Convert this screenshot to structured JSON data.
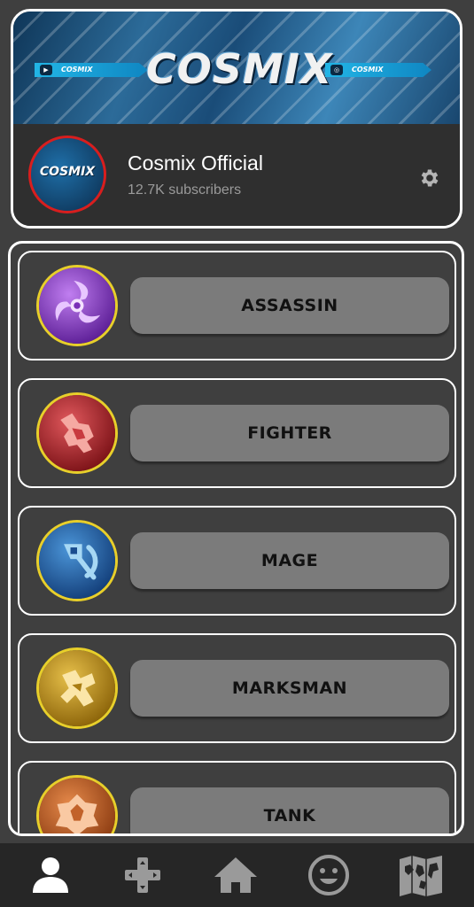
{
  "channel": {
    "banner_title": "COSMIX",
    "banner_left_tag": "COSMIX",
    "banner_right_tag": "COSMIX",
    "avatar_text": "COSMIX",
    "name": "Cosmix Official",
    "subscribers": "12.7K subscribers",
    "settings_icon": "gear-icon"
  },
  "roles": [
    {
      "label": "ASSASSIN",
      "icon": "assassin-icon",
      "color": "#8a3fc4"
    },
    {
      "label": "FIGHTER",
      "icon": "fighter-icon",
      "color": "#b4262c"
    },
    {
      "label": "MAGE",
      "icon": "mage-icon",
      "color": "#1f5fa8"
    },
    {
      "label": "MARKSMAN",
      "icon": "marksman-icon",
      "color": "#c49a14"
    },
    {
      "label": "TANK",
      "icon": "tank-icon",
      "color": "#c4682a"
    }
  ],
  "nav": [
    {
      "icon": "profile-icon",
      "active": true
    },
    {
      "icon": "gamepad-icon",
      "active": false
    },
    {
      "icon": "home-icon",
      "active": false
    },
    {
      "icon": "smiley-icon",
      "active": false
    },
    {
      "icon": "map-icon",
      "active": false
    }
  ],
  "colors": {
    "background": "#3f3f3f",
    "button": "#7b7b7b",
    "nav_bar": "#262626",
    "active_nav": "#ffffff",
    "inactive_nav": "#9a9a9a"
  }
}
